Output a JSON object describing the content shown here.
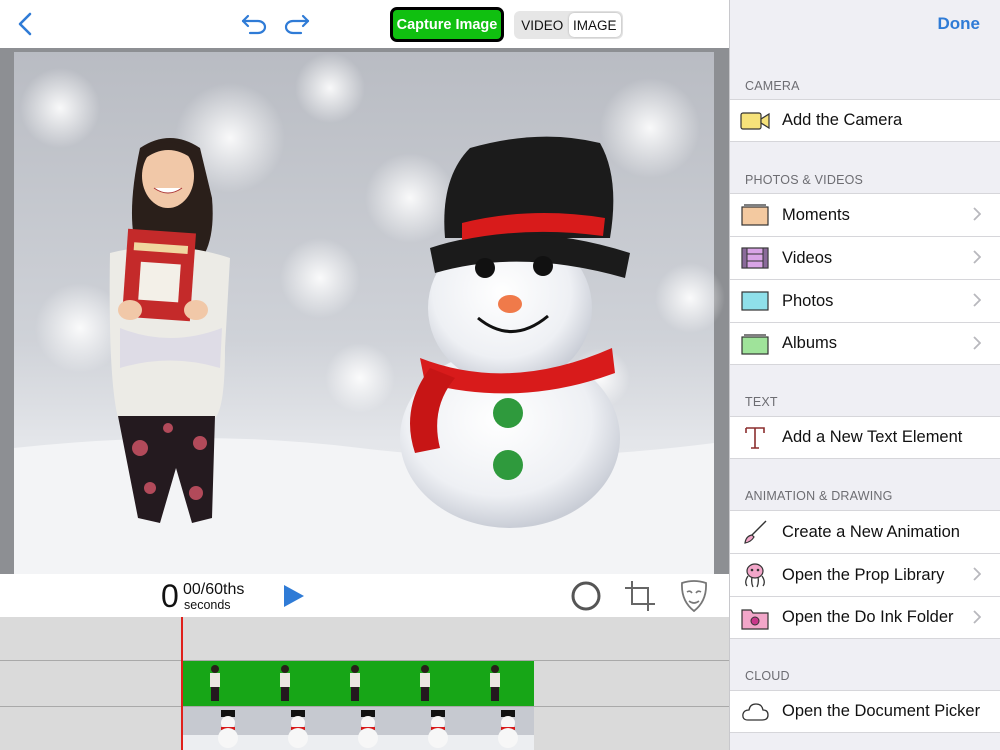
{
  "topbar": {
    "capture_label": "Capture Image",
    "mode_video": "VIDEO",
    "mode_image": "IMAGE",
    "active_mode": "IMAGE"
  },
  "playback": {
    "time_value": "0",
    "time_fraction": "00/60ths",
    "time_unit": "seconds"
  },
  "panel": {
    "done_label": "Done",
    "sections": {
      "camera": "CAMERA",
      "photos_videos": "PHOTOS & VIDEOS",
      "text": "TEXT",
      "animation_drawing": "ANIMATION & DRAWING",
      "cloud": "CLOUD"
    },
    "items": {
      "add_camera": "Add the Camera",
      "moments": "Moments",
      "videos": "Videos",
      "photos": "Photos",
      "albums": "Albums",
      "add_text": "Add a New Text Element",
      "create_animation": "Create a New Animation",
      "prop_library": "Open the Prop Library",
      "doink_folder": "Open the Do Ink Folder",
      "document_picker": "Open the Document Picker"
    }
  },
  "colors": {
    "accent_blue": "#2f7bd6",
    "capture_green": "#10c010",
    "playhead_red": "#e0201b",
    "green_screen": "#17a617"
  }
}
